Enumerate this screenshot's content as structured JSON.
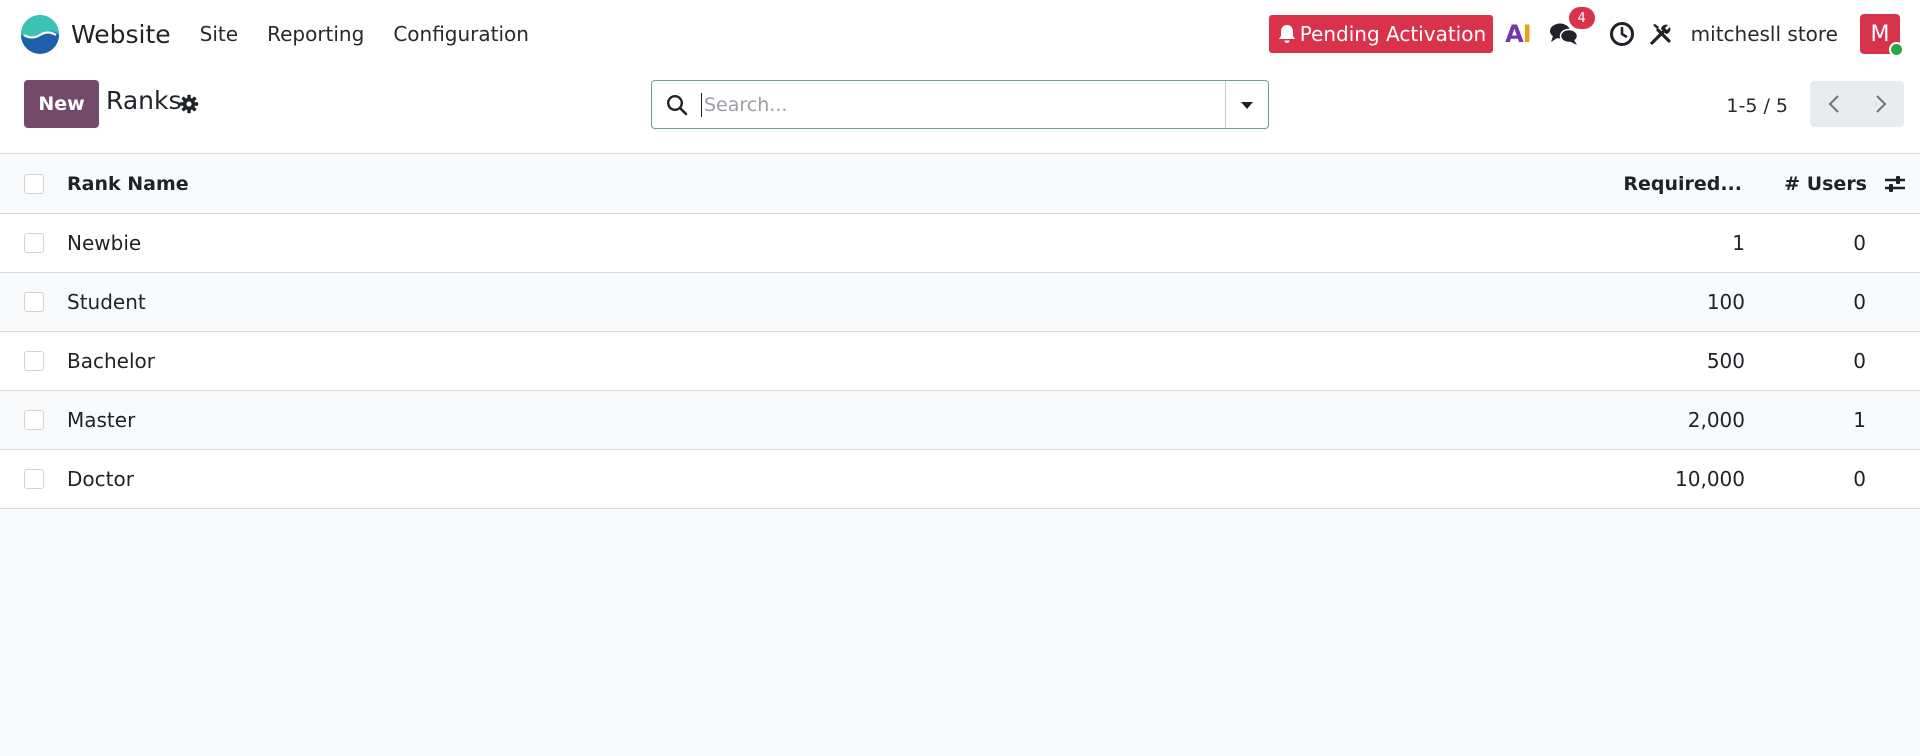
{
  "navbar": {
    "app_name": "Website",
    "menu": [
      {
        "label": "Site"
      },
      {
        "label": "Reporting"
      },
      {
        "label": "Configuration"
      }
    ],
    "pending_label": "Pending Activation",
    "ai_label_a": "A",
    "ai_label_i": "I",
    "messages_count": "4",
    "company": "mitchesll store",
    "avatar_letter": "M"
  },
  "control_panel": {
    "new_label": "New",
    "title": "Ranks",
    "search_placeholder": "Search...",
    "search_value": "",
    "pager_text": "1-5 / 5"
  },
  "table": {
    "columns": {
      "name": "Rank Name",
      "required": "Required...",
      "users": "# Users"
    },
    "rows": [
      {
        "name": "Newbie",
        "required": "1",
        "users": "0"
      },
      {
        "name": "Student",
        "required": "100",
        "users": "0"
      },
      {
        "name": "Bachelor",
        "required": "500",
        "users": "0"
      },
      {
        "name": "Master",
        "required": "2,000",
        "users": "1"
      },
      {
        "name": "Doctor",
        "required": "10,000",
        "users": "0"
      }
    ]
  },
  "colors": {
    "brand": "#714b67",
    "danger": "#d9334b",
    "online": "#28a745"
  },
  "icons": {
    "logo": "website-app-logo",
    "bell": "bell-icon",
    "chat": "chat-icon",
    "clock": "clock-icon",
    "tools": "tools-icon",
    "gear": "gear-icon",
    "search": "search-icon",
    "dropdown": "caret-down-icon",
    "prev": "chevron-left-icon",
    "next": "chevron-right-icon",
    "optional_columns": "sliders-icon"
  }
}
